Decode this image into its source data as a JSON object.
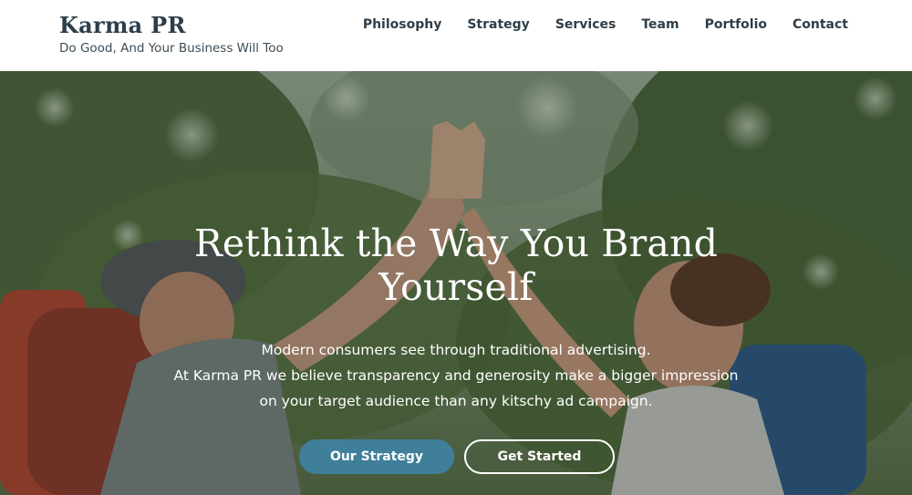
{
  "header": {
    "site_title": "Karma PR",
    "tagline": "Do Good, And Your Business Will Too",
    "nav": [
      {
        "label": "Philosophy"
      },
      {
        "label": "Strategy"
      },
      {
        "label": "Services"
      },
      {
        "label": "Team"
      },
      {
        "label": "Portfolio"
      },
      {
        "label": "Contact"
      }
    ]
  },
  "hero": {
    "title": "Rethink the Way You Brand Yourself",
    "description_lines": [
      "Modern consumers see through traditional advertising.",
      "At Karma PR we believe transparency and generosity make a bigger impression",
      "on your target audience than any kitschy ad campaign."
    ],
    "primary_button": "Our Strategy",
    "secondary_button": "Get Started"
  },
  "colors": {
    "title_text": "#2c3e4a",
    "accent_button": "#3f7f99",
    "foliage": "#4f6b3f"
  }
}
